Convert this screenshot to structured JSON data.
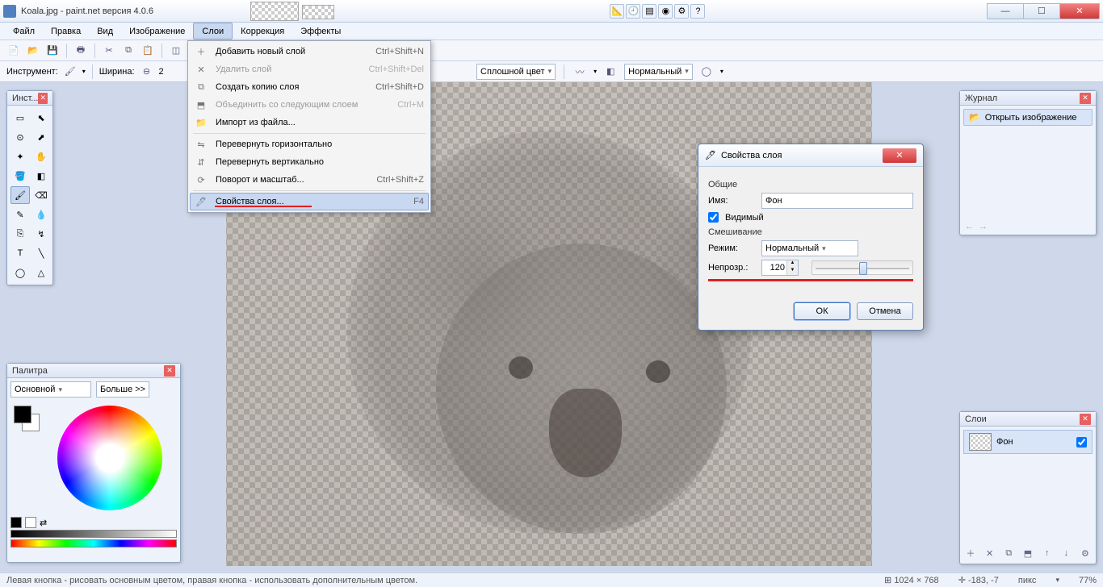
{
  "app": {
    "title": "Koala.jpg - paint.net версия 4.0.6"
  },
  "menubar": [
    "Файл",
    "Правка",
    "Вид",
    "Изображение",
    "Слои",
    "Коррекция",
    "Эффекты"
  ],
  "menubar_active_index": 4,
  "toolbar2": {
    "instrument_label": "Инструмент:",
    "width_label": "Ширина:",
    "width_value": "2",
    "fill_label": "Сплошной цвет",
    "blend_label": "Нормальный"
  },
  "dropdown": {
    "items": [
      {
        "label": "Добавить новый слой",
        "shortcut": "Ctrl+Shift+N",
        "icon": "plus-icon",
        "disabled": false
      },
      {
        "label": "Удалить слой",
        "shortcut": "Ctrl+Shift+Del",
        "icon": "x-icon",
        "disabled": true
      },
      {
        "label": "Создать копию слоя",
        "shortcut": "Ctrl+Shift+D",
        "icon": "duplicate-icon",
        "disabled": false
      },
      {
        "label": "Объединить со следующим слоем",
        "shortcut": "Ctrl+M",
        "icon": "merge-icon",
        "disabled": true
      },
      {
        "label": "Импорт из файла...",
        "shortcut": "",
        "icon": "import-icon",
        "disabled": false
      },
      {
        "sep": true
      },
      {
        "label": "Перевернуть горизонтально",
        "shortcut": "",
        "icon": "fliph-icon",
        "disabled": false
      },
      {
        "label": "Перевернуть вертикально",
        "shortcut": "",
        "icon": "flipv-icon",
        "disabled": false
      },
      {
        "label": "Поворот и масштаб...",
        "shortcut": "Ctrl+Shift+Z",
        "icon": "rotate-icon",
        "disabled": false
      },
      {
        "sep": true
      },
      {
        "label": "Свойства слоя...",
        "shortcut": "F4",
        "icon": "props-icon",
        "disabled": false,
        "highlight": true,
        "underline": true
      }
    ]
  },
  "tools_panel": {
    "title": "Инст..."
  },
  "palette_panel": {
    "title": "Палитра",
    "combo": "Основной",
    "more": "Больше >>"
  },
  "history_panel": {
    "title": "Журнал",
    "item": "Открыть изображение"
  },
  "layers_panel": {
    "title": "Слои",
    "layer_name": "Фон"
  },
  "dialog": {
    "title": "Свойства слоя",
    "section_general": "Общие",
    "name_label": "Имя:",
    "name_value": "Фон",
    "visible_label": "Видимый",
    "section_blend": "Смешивание",
    "mode_label": "Режим:",
    "mode_value": "Нормальный",
    "opacity_label": "Непрозр.:",
    "opacity_value": "120",
    "ok": "ОК",
    "cancel": "Отмена"
  },
  "status": {
    "hint": "Левая кнопка - рисовать основным цветом, правая кнопка - использовать дополнительным цветом.",
    "dims": "1024 × 768",
    "pos": "-183, -7",
    "unit": "пикс",
    "zoom": "77%"
  }
}
